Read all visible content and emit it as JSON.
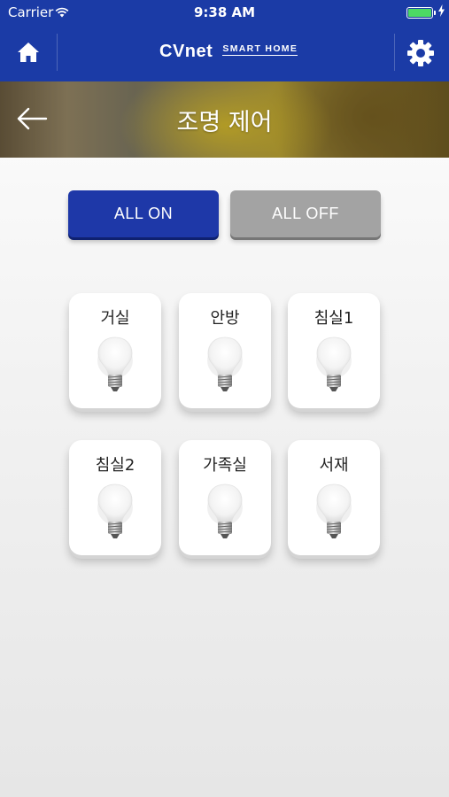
{
  "status_bar": {
    "carrier": "Carrier",
    "time": "9:38 AM",
    "battery_level": 1.0
  },
  "header": {
    "brand": "CVnet",
    "brand_sub": "SMART HOME",
    "home_icon": "home-icon",
    "settings_icon": "gear-icon",
    "color": "#1b3ba6"
  },
  "banner": {
    "title": "조명 제어",
    "back_icon": "back-arrow-icon"
  },
  "controls": {
    "all_on": "ALL ON",
    "all_off": "ALL OFF",
    "on_color": "#1e38a8",
    "off_color": "#a3a3a3"
  },
  "rooms": [
    {
      "label": "거실",
      "icon": "light-bulb-icon"
    },
    {
      "label": "안방",
      "icon": "light-bulb-icon"
    },
    {
      "label": "침실1",
      "icon": "light-bulb-icon"
    },
    {
      "label": "침실2",
      "icon": "light-bulb-icon"
    },
    {
      "label": "가족실",
      "icon": "light-bulb-icon"
    },
    {
      "label": "서재",
      "icon": "light-bulb-icon"
    }
  ]
}
